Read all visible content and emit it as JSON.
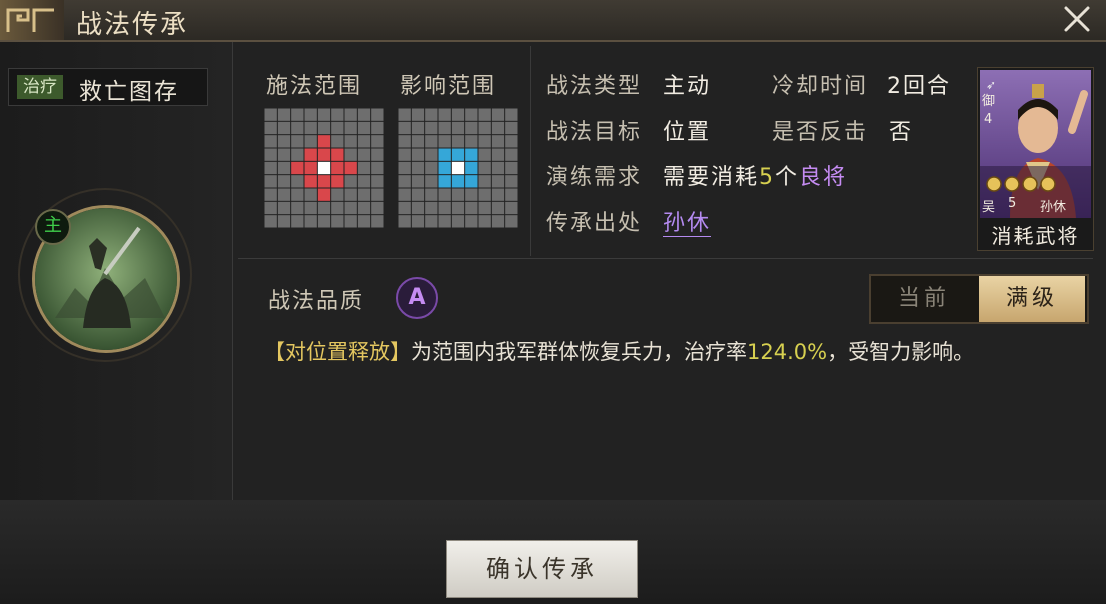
{
  "window": {
    "title": "战法传承"
  },
  "skill": {
    "type_tag": "治疗",
    "name": "救亡图存",
    "main_badge": "主"
  },
  "ranges": {
    "cast_label": "施法范围",
    "effect_label": "影响范围",
    "cast_color": "#d9474b",
    "effect_color": "#35a7d8"
  },
  "info": {
    "type_label": "战法类型",
    "type_value": "主动",
    "cooldown_label": "冷却时间",
    "cooldown_value": "2回合",
    "target_label": "战法目标",
    "target_value": "位置",
    "counter_label": "是否反击",
    "counter_value": "否",
    "req_label": "演练需求",
    "req_prefix": "需要消耗",
    "req_count": "5",
    "req_unit": "个",
    "req_grade": "良将",
    "origin_label": "传承出处",
    "origin_value": "孙休"
  },
  "hero_card": {
    "unit_icon": "crossbow-icon",
    "unit_label": "御",
    "cost": "4",
    "faction": "吴",
    "level": "5",
    "name": "孙休",
    "caption": "消耗武将",
    "star_count": 4
  },
  "quality": {
    "label": "战法品质",
    "grade": "A"
  },
  "level_toggle": {
    "current": "当前",
    "max": "满级"
  },
  "description": {
    "tag": "【对位置释放】",
    "text_a": "为范围内我军群体恢复兵力，治疗率",
    "rate": "124.0%",
    "text_b": "，受智力影响。"
  },
  "footer": {
    "confirm_label": "确认传承"
  },
  "colors": {
    "accent_gold": "#e4c760",
    "grade_purple": "#c58cf2",
    "origin_purple": "#b48af0",
    "count_yellow": "#d7d050"
  }
}
